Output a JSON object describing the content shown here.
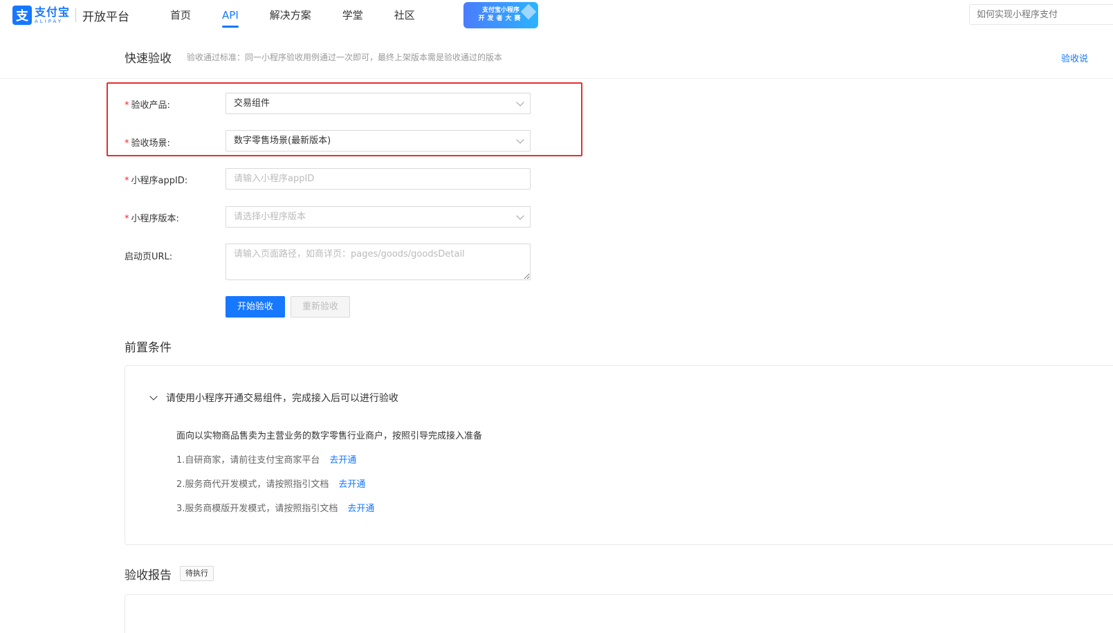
{
  "header": {
    "logo_cn": "支付宝",
    "logo_en": "ALIPAY",
    "logo_mark": "支",
    "platform": "开放平台",
    "nav": [
      {
        "label": "首页",
        "active": false
      },
      {
        "label": "API",
        "active": true
      },
      {
        "label": "解决方案",
        "active": false
      },
      {
        "label": "学堂",
        "active": false
      },
      {
        "label": "社区",
        "active": false
      }
    ],
    "banner_line1": "支付宝小程序",
    "banner_line2": "开发者大赛",
    "search_placeholder": "如何实现小程序支付"
  },
  "quick_check": {
    "title": "快速验收",
    "subtitle": "验收通过标准：同一小程序验收用例通过一次即可，最终上架版本需是验收通过的版本",
    "right_link": "验收说"
  },
  "form": {
    "required_mark": "*",
    "product_label": "验收产品:",
    "product_value": "交易组件",
    "scene_label": "验收场景:",
    "scene_value": "数字零售场景(最新版本)",
    "appid_label": "小程序appID:",
    "appid_placeholder": "请输入小程序appID",
    "version_label": "小程序版本:",
    "version_placeholder": "请选择小程序版本",
    "url_label": "启动页URL:",
    "url_placeholder": "请输入页面路径，如商详页：pages/goods/goodsDetail",
    "start_button": "开始验收",
    "restart_button": "重新验收"
  },
  "preconditions": {
    "title": "前置条件",
    "heading": "请使用小程序开通交易组件，完成接入后可以进行验收",
    "description": "面向以实物商品售卖为主营业务的数字零售行业商户，按照引导完成接入准备",
    "items": [
      {
        "text": "1.自研商家，请前往支付宝商家平台",
        "link": "去开通"
      },
      {
        "text": "2.服务商代开发模式，请按照指引文档",
        "link": "去开通"
      },
      {
        "text": "3.服务商模版开发模式，请按照指引文档",
        "link": "去开通"
      }
    ]
  },
  "report": {
    "title": "验收报告",
    "status": "待执行"
  },
  "colors": {
    "brand": "#1677ff",
    "highlight": "#e62e2e",
    "required": "#f5222d"
  }
}
